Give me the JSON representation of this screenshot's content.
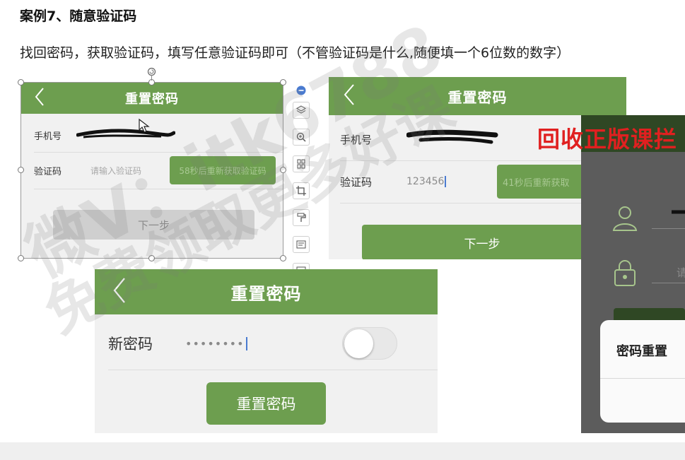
{
  "case": {
    "title": "案例7、随意验证码",
    "description": "找回密码，获取验证码，填写任意验证码即可（不管验证码是什么,随便填一个6位数的数字）"
  },
  "screen1": {
    "title": "重置密码",
    "phone_label": "手机号",
    "code_label": "验证码",
    "code_placeholder": "请输入验证码",
    "resend_label": "58秒后重新获取验证码",
    "next_label": "下一步"
  },
  "screen2": {
    "title": "重置密码",
    "phone_label": "手机号",
    "code_label": "验证码",
    "code_value": "123456",
    "resend_label": "41秒后重新获取",
    "next_label": "下一步"
  },
  "screen3": {
    "title": "重置密码",
    "new_password_label": "新密码",
    "password_mask": "••••••••",
    "show_password_toggle": false,
    "reset_label": "重置密码"
  },
  "overlay": {
    "banner": "回收正版课拦",
    "dialog_text": "密码重置",
    "field_hint": "请"
  },
  "watermark": {
    "line1": "微V：itk6788",
    "line2": "免费领取更多好课"
  },
  "colors": {
    "accent": "#6d9e4f",
    "banner_red": "#e02020",
    "dark_panel": "#5c5c5c"
  },
  "icons": {
    "back": "chevron-left-icon",
    "toolbar": [
      "layers-icon",
      "zoom-icon",
      "crop-frame-icon",
      "crop-icon",
      "format-painter-icon",
      "picture-ocr-icon",
      "image-edit-icon"
    ]
  }
}
